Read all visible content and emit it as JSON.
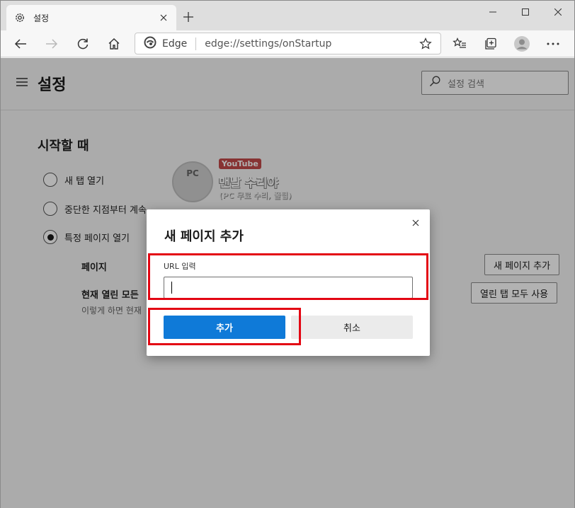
{
  "browser": {
    "tab_title": "설정",
    "address_site": "Edge",
    "address_url": "edge://settings/onStartup"
  },
  "settings": {
    "page_title": "설정",
    "search_placeholder": "설정 검색",
    "section_title": "시작할 때",
    "options": [
      {
        "label": "새 탭 열기",
        "selected": false
      },
      {
        "label": "중단한 지점부터 계속",
        "selected": false
      },
      {
        "label": "특정 페이지 열기",
        "selected": true
      }
    ],
    "pages_label": "페이지",
    "add_page_button": "새 페이지 추가",
    "current_open_label": "현재 열린 모든",
    "current_open_hint": "이렇게 하면 현재",
    "use_open_tabs_button": "열린 탭 모두 사용"
  },
  "watermark": {
    "logo_text": "PC",
    "youtube": "YouTube",
    "title": "맨날 수리야",
    "subtitle": "(PC 무료 수리, 꿀팁)"
  },
  "dialog": {
    "title": "새 페이지 추가",
    "url_label": "URL 입력",
    "url_value": "",
    "add_button": "추가",
    "cancel_button": "취소"
  },
  "colors": {
    "primary_button": "#0f7ad8",
    "highlight": "#e30613"
  }
}
